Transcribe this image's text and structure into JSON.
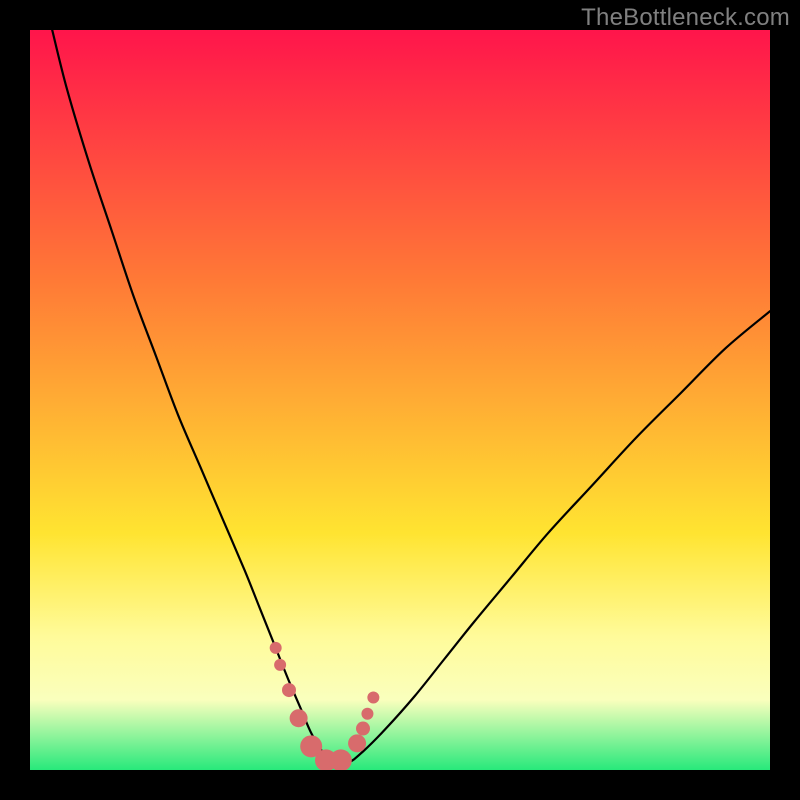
{
  "watermark": "TheBottleneck.com",
  "colors": {
    "frame": "#000000",
    "curve": "#000000",
    "marker_fill": "#d86b6c",
    "marker_stroke": "#b85556",
    "grad_top": "#ff154b",
    "grad_mid_upper": "#ff7a36",
    "grad_mid": "#ffe431",
    "grad_low_band_top": "#fffb9a",
    "grad_low_band": "#faffbd",
    "grad_bottom": "#27e97b"
  },
  "chart_data": {
    "type": "line",
    "title": "",
    "xlabel": "",
    "ylabel": "",
    "xlim": [
      0,
      100
    ],
    "ylim": [
      0,
      100
    ],
    "series": [
      {
        "name": "bottleneck-curve",
        "x": [
          3,
          5,
          8,
          11,
          14,
          17,
          20,
          23,
          26,
          29,
          31,
          33,
          35,
          36.5,
          38,
          39.5,
          41,
          43,
          45,
          48,
          52,
          56,
          60,
          65,
          70,
          76,
          82,
          88,
          94,
          100
        ],
        "y": [
          100,
          92,
          82,
          73,
          64,
          56,
          48,
          41,
          34,
          27,
          22,
          17,
          12,
          8.5,
          5,
          2.5,
          1,
          1,
          2.5,
          5.5,
          10,
          15,
          20,
          26,
          32,
          38.5,
          45,
          51,
          57,
          62
        ]
      }
    ],
    "markers": {
      "name": "highlighted-points",
      "x": [
        33.2,
        33.8,
        35.0,
        36.3,
        38.0,
        40.0,
        42.0,
        44.2,
        45.0,
        45.6,
        46.4
      ],
      "y": [
        16.5,
        14.2,
        10.8,
        7.0,
        3.2,
        1.3,
        1.3,
        3.6,
        5.6,
        7.6,
        9.8
      ],
      "r": [
        6,
        6,
        7,
        9,
        11,
        11,
        11,
        9,
        7,
        6,
        6
      ]
    }
  }
}
